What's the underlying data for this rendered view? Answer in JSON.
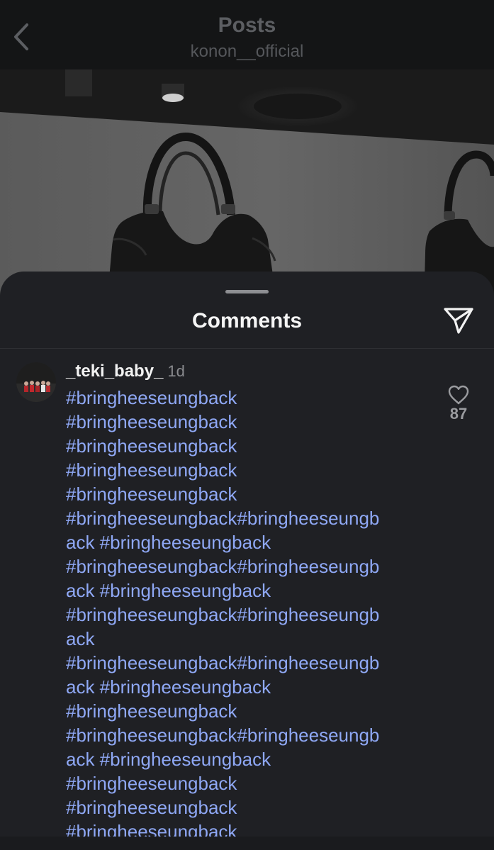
{
  "nav": {
    "title": "Posts",
    "subtitle": "konon__official",
    "back_icon": "chevron-left-icon"
  },
  "photo": {
    "description_icon": "post-image"
  },
  "comments_sheet": {
    "title": "Comments",
    "send_icon": "paper-plane-icon"
  },
  "comment": {
    "username": "_teki_baby_",
    "time": "1d",
    "like_icon": "heart-outline-icon",
    "like_count": "87",
    "lines": [
      "#bringheeseungback",
      "#bringheeseungback",
      "#bringheeseungback",
      "#bringheeseungback",
      "#bringheeseungback",
      "#bringheeseungback#bringheeseungb",
      "ack #bringheeseungback",
      "#bringheeseungback#bringheeseungb",
      "ack #bringheeseungback",
      "#bringheeseungback#bringheeseungb",
      "ack",
      "#bringheeseungback#bringheeseungb",
      "ack #bringheeseungback",
      "#bringheeseungback",
      "#bringheeseungback#bringheeseungb",
      "ack #bringheeseungback",
      "#bringheeseungback",
      "#bringheeseungback",
      "#bringheeseungback"
    ]
  },
  "colors": {
    "hashtag": "#8fa8f5",
    "sheet_bg": "#1f2024",
    "topbar_bg": "#141516"
  }
}
